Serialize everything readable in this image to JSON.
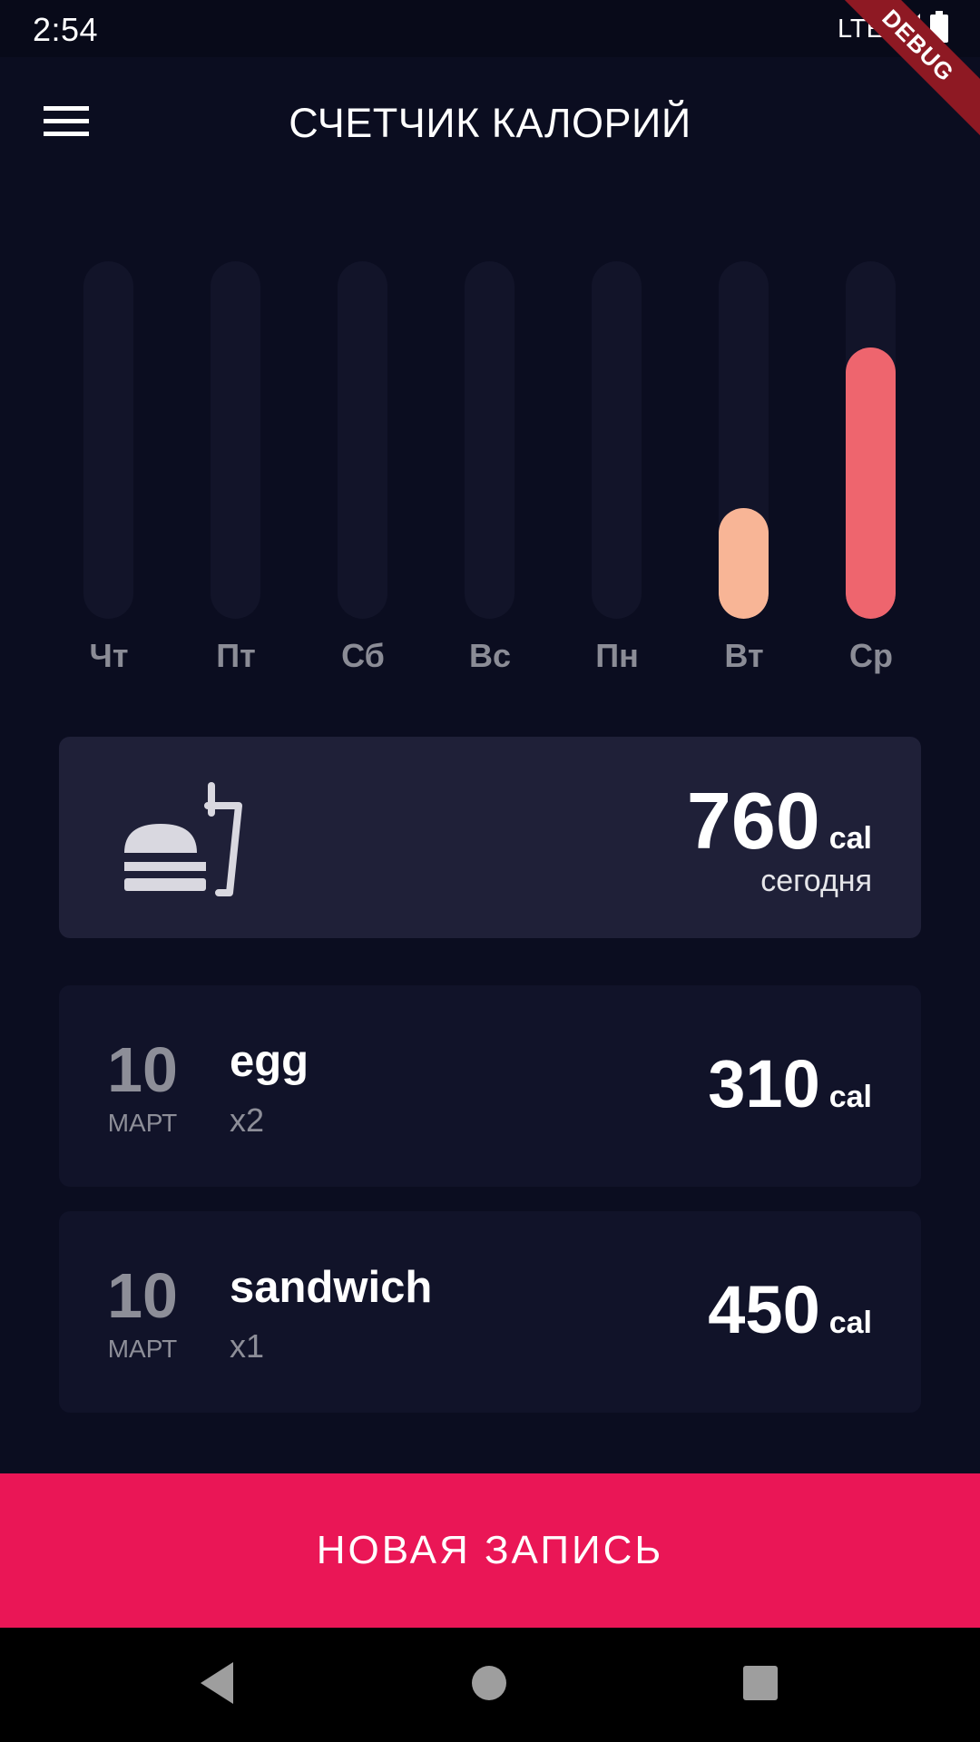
{
  "status_bar": {
    "time": "2:54",
    "network": "LTE",
    "debug_label": "DEBUG"
  },
  "app_bar": {
    "title": "СЧЕТЧИК КАЛОРИЙ",
    "menu_icon": "hamburger-menu-icon"
  },
  "chart_data": {
    "type": "bar",
    "categories": [
      "Чт",
      "Пт",
      "Сб",
      "Вс",
      "Пн",
      "Вт",
      "Ср"
    ],
    "values": [
      0,
      0,
      0,
      0,
      0,
      310,
      760
    ],
    "ylim": [
      0,
      1000
    ],
    "colors": [
      "#f8b596",
      "#f8b596",
      "#f8b596",
      "#f8b596",
      "#f8b596",
      "#f8b596",
      "#ee656e"
    ],
    "track_color": "#121429"
  },
  "summary": {
    "value": "760",
    "unit": "cal",
    "label": "сегодня",
    "icon": "fast-food-icon"
  },
  "entries": [
    {
      "day": "10",
      "month": "МАРТ",
      "name": "egg",
      "qty": "x2",
      "calories": "310",
      "unit": "cal"
    },
    {
      "day": "10",
      "month": "МАРТ",
      "name": "sandwich",
      "qty": "x1",
      "calories": "450",
      "unit": "cal"
    }
  ],
  "actions": {
    "new_entry_label": "НОВАЯ ЗАПИСЬ"
  },
  "nav_bar": {
    "back_icon": "back-triangle-icon",
    "home_icon": "home-circle-icon",
    "recents_icon": "recents-square-icon"
  },
  "colors": {
    "background": "#0b0d20",
    "accent": "#ea1656",
    "card": "#1f2038",
    "entry_card": "#111329"
  }
}
